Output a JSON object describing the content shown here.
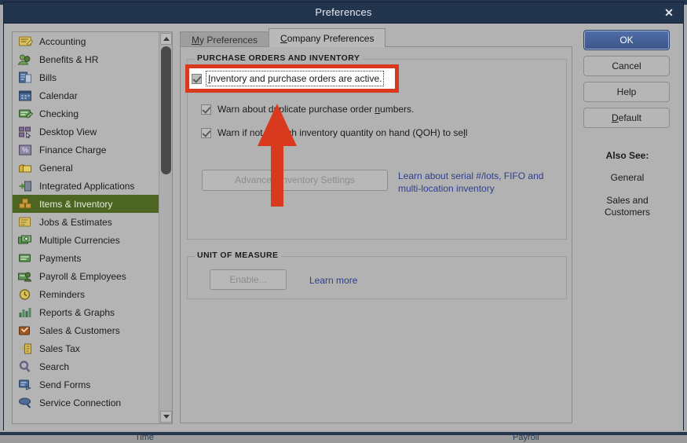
{
  "window": {
    "title": "Preferences",
    "close_label": "✕"
  },
  "tabs": [
    {
      "label": "My Preferences",
      "accel": "M",
      "rest": "y Preferences",
      "active": false
    },
    {
      "label": "Company Preferences",
      "accel": "C",
      "rest": "ompany Preferences",
      "active": true
    }
  ],
  "sidebar": {
    "items": [
      {
        "label": "Accounting",
        "icon": "accounting-icon",
        "selected": false
      },
      {
        "label": "Benefits & HR",
        "icon": "benefits-hr-icon",
        "selected": false
      },
      {
        "label": "Bills",
        "icon": "bills-icon",
        "selected": false
      },
      {
        "label": "Calendar",
        "icon": "calendar-icon",
        "selected": false
      },
      {
        "label": "Checking",
        "icon": "checking-icon",
        "selected": false
      },
      {
        "label": "Desktop View",
        "icon": "desktop-view-icon",
        "selected": false
      },
      {
        "label": "Finance Charge",
        "icon": "finance-charge-icon",
        "selected": false
      },
      {
        "label": "General",
        "icon": "general-icon",
        "selected": false
      },
      {
        "label": "Integrated Applications",
        "icon": "integrated-applications-icon",
        "selected": false
      },
      {
        "label": "Items & Inventory",
        "icon": "items-inventory-icon",
        "selected": true
      },
      {
        "label": "Jobs & Estimates",
        "icon": "jobs-estimates-icon",
        "selected": false
      },
      {
        "label": "Multiple Currencies",
        "icon": "multiple-currencies-icon",
        "selected": false
      },
      {
        "label": "Payments",
        "icon": "payments-icon",
        "selected": false
      },
      {
        "label": "Payroll & Employees",
        "icon": "payroll-employees-icon",
        "selected": false
      },
      {
        "label": "Reminders",
        "icon": "reminders-icon",
        "selected": false
      },
      {
        "label": "Reports & Graphs",
        "icon": "reports-graphs-icon",
        "selected": false
      },
      {
        "label": "Sales & Customers",
        "icon": "sales-customers-icon",
        "selected": false
      },
      {
        "label": "Sales Tax",
        "icon": "sales-tax-icon",
        "selected": false
      },
      {
        "label": "Search",
        "icon": "search-icon",
        "selected": false
      },
      {
        "label": "Send Forms",
        "icon": "send-forms-icon",
        "selected": false
      },
      {
        "label": "Service Connection",
        "icon": "service-connection-icon",
        "selected": false
      }
    ]
  },
  "content": {
    "po_group": {
      "title": "PURCHASE ORDERS AND INVENTORY",
      "checkboxes": [
        {
          "label": "Inventory and purchase orders are active.",
          "accel_prefix": "I",
          "accel_rest": "nventory and purchase orders are active.",
          "checked": true,
          "focused": true
        },
        {
          "label": "Warn about duplicate purchase order numbers.",
          "pre": "Warn about duplicate purchase order ",
          "accel": "n",
          "post": "umbers.",
          "checked": true,
          "focused": false
        },
        {
          "label": "Warn if not enough inventory quantity on hand (QOH) to sell",
          "pre": "Warn if not enough inventory quantity on hand (QOH) to se",
          "accel": "l",
          "post": "l",
          "checked": true,
          "focused": false
        }
      ],
      "advanced_button": "Advanced Inventory Settings",
      "advanced_link_line1": "Learn about serial #/lots, FIFO and",
      "advanced_link_line2": "multi-location inventory"
    },
    "uom_group": {
      "title": "UNIT OF MEASURE",
      "enable_button": "Enable...",
      "learn_more_link": "Learn more"
    }
  },
  "right_panel": {
    "buttons": [
      {
        "label": "OK",
        "style": "primary"
      },
      {
        "label": "Cancel",
        "style": "normal"
      },
      {
        "label": "Help",
        "style": "normal"
      },
      {
        "label": "Default",
        "style": "normal",
        "accel": "D",
        "rest": "efault"
      }
    ],
    "also_see_heading": "Also See:",
    "also_see_links": [
      {
        "line1": "General",
        "line2": ""
      },
      {
        "line1": "Sales and",
        "line2": "Customers"
      }
    ]
  },
  "background": {
    "label_left": "Time",
    "label_right": "Payroll"
  },
  "annotation": {
    "highlight_color": "#d9391c",
    "arrow_color": "#d9391c",
    "highlighted_target": "Inventory and purchase orders are active.",
    "arrow_points_to": "Inventory and purchase orders are active."
  },
  "colors": {
    "titlebar": "#23344d",
    "dialog_bg": "#b2b2b2",
    "selected_item": "#4c6621",
    "link": "#2d3f8c",
    "primary_button": "#3c5589",
    "annotation_red": "#d9391c"
  }
}
